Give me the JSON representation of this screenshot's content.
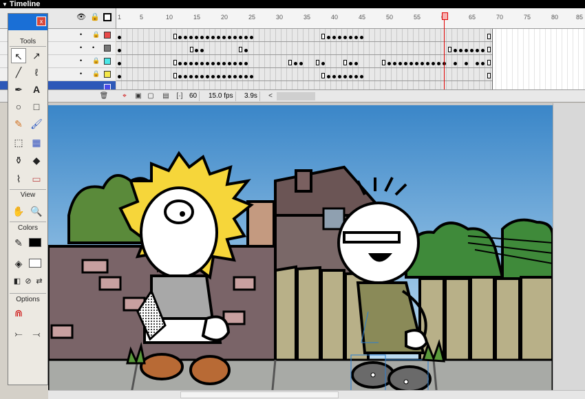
{
  "timeline": {
    "title": "Timeline",
    "ruler_ticks": [
      "1",
      "5",
      "10",
      "15",
      "20",
      "25",
      "30",
      "35",
      "40",
      "45",
      "50",
      "55",
      "60",
      "65",
      "70",
      "75",
      "80",
      "85"
    ],
    "current_frame": "60",
    "fps": "15.0 fps",
    "elapsed": "3.9s",
    "scroll_left": "<"
  },
  "layers": [
    {
      "color": "#e84a4a"
    },
    {
      "color": "#777777"
    },
    {
      "color": "#4ae8e8"
    },
    {
      "color": "#f4e84a"
    },
    {
      "color": "#4a4ae8"
    }
  ],
  "tools_panel": {
    "sections": {
      "tools": "Tools",
      "view": "View",
      "colors": "Colors",
      "options": "Options"
    },
    "tool_icons": [
      "arrow-icon",
      "subselect-icon",
      "line-icon",
      "lasso-icon",
      "pen-icon",
      "text-icon",
      "oval-icon",
      "rectangle-icon",
      "pencil-icon",
      "brush-icon",
      "free-transform-icon",
      "fill-transform-icon",
      "ink-bottle-icon",
      "paint-bucket-icon",
      "eyedropper-icon",
      "eraser-icon",
      "hand-icon",
      "zoom-icon"
    ],
    "stroke_color": "#000000",
    "fill_color": "#ffffff",
    "close_label": "x"
  }
}
